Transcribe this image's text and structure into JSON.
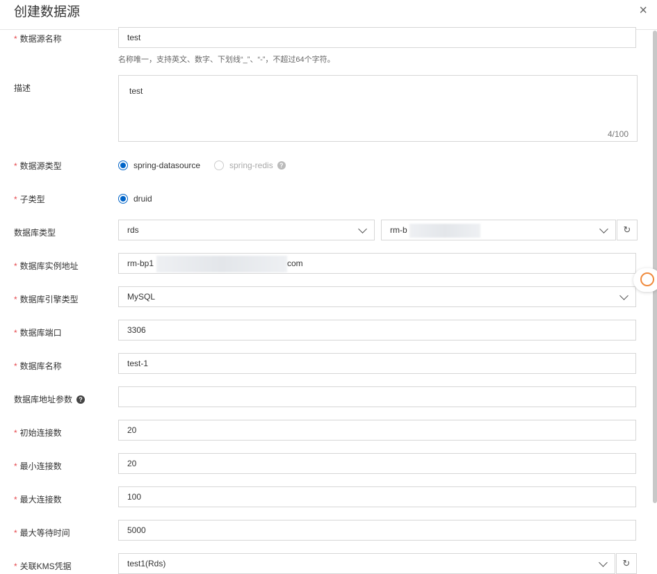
{
  "dialog": {
    "title": "创建数据源",
    "close_icon": "×"
  },
  "form": {
    "name": {
      "label": "数据源名称",
      "required": "*",
      "value": "test",
      "help": "名称唯一，支持英文、数字、下划线“_”、“-”，不超过64个字符。"
    },
    "description": {
      "label": "描述",
      "value": "test",
      "count": "4/100"
    },
    "source_type": {
      "label": "数据源类型",
      "required": "*",
      "options": [
        "spring-datasource",
        "spring-redis"
      ],
      "selected": "spring-datasource"
    },
    "sub_type": {
      "label": "子类型",
      "required": "*",
      "options": [
        "druid"
      ],
      "selected": "druid"
    },
    "db_type": {
      "label": "数据库类型",
      "value": "rds",
      "instance_value": "rm-b"
    },
    "instance_address": {
      "label": "数据库实例地址",
      "required": "*",
      "value_prefix": "rm-bp1",
      "value_suffix": "com"
    },
    "engine_type": {
      "label": "数据库引擎类型",
      "required": "*",
      "value": "MySQL"
    },
    "port": {
      "label": "数据库端口",
      "required": "*",
      "value": "3306"
    },
    "db_name": {
      "label": "数据库名称",
      "required": "*",
      "value": "test-1"
    },
    "address_params": {
      "label": "数据库地址参数",
      "value": ""
    },
    "initial_connections": {
      "label": "初始连接数",
      "required": "*",
      "value": "20"
    },
    "min_connections": {
      "label": "最小连接数",
      "required": "*",
      "value": "20"
    },
    "max_connections": {
      "label": "最大连接数",
      "required": "*",
      "value": "100"
    },
    "max_wait": {
      "label": "最大等待时间",
      "required": "*",
      "value": "5000"
    },
    "kms": {
      "label": "关联KMS凭据",
      "required": "*",
      "value": "test1(Rds)"
    }
  },
  "icons": {
    "refresh": "↻",
    "help": "?"
  },
  "colors": {
    "primary": "#0064c8",
    "required": "#e5484d",
    "border": "#d6d6d6"
  }
}
